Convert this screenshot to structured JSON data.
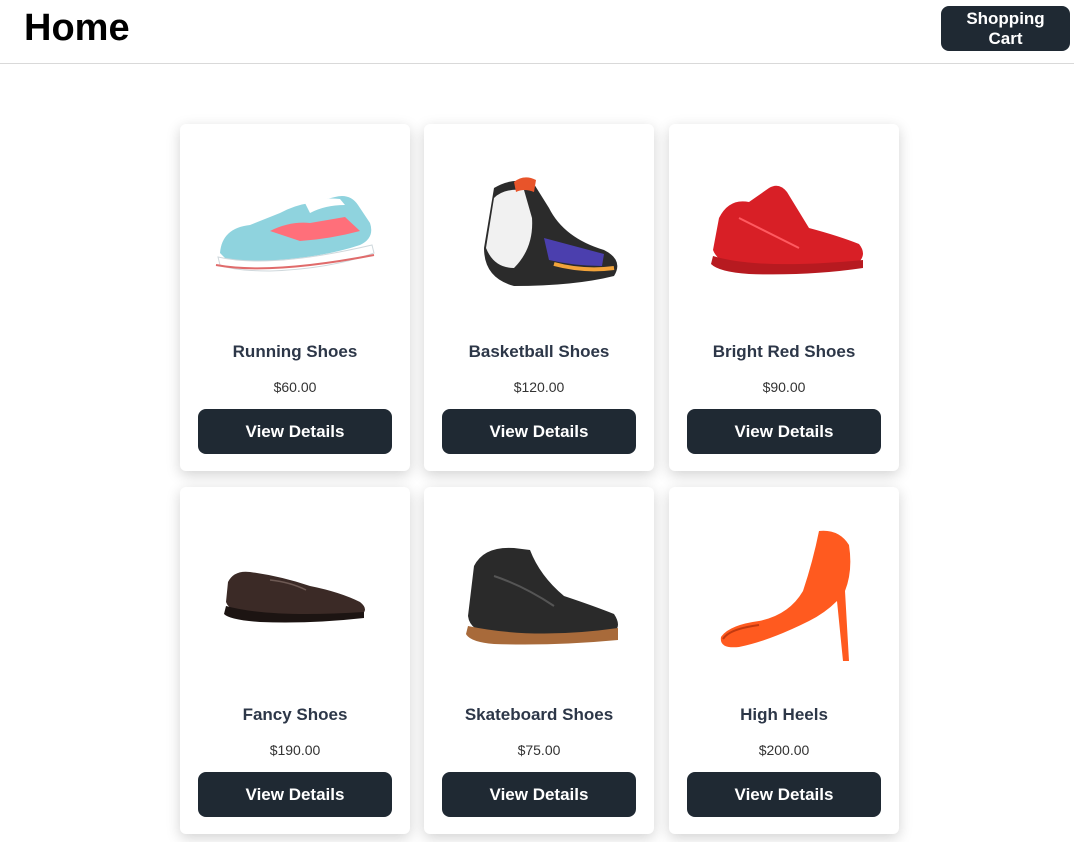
{
  "header": {
    "title": "Home",
    "cart_label": "Shopping Cart"
  },
  "products": [
    {
      "name": "Running Shoes",
      "price": "$60.00",
      "button": "View Details",
      "icon": "running-shoe-icon"
    },
    {
      "name": "Basketball Shoes",
      "price": "$120.00",
      "button": "View Details",
      "icon": "basketball-shoe-icon"
    },
    {
      "name": "Bright Red Shoes",
      "price": "$90.00",
      "button": "View Details",
      "icon": "red-shoe-icon"
    },
    {
      "name": "Fancy Shoes",
      "price": "$190.00",
      "button": "View Details",
      "icon": "dress-shoe-icon"
    },
    {
      "name": "Skateboard Shoes",
      "price": "$75.00",
      "button": "View Details",
      "icon": "skate-shoe-icon"
    },
    {
      "name": "High Heels",
      "price": "$200.00",
      "button": "View Details",
      "icon": "high-heel-icon"
    }
  ],
  "colors": {
    "button_bg": "#1f2933",
    "button_text": "#ffffff",
    "name_text": "#2d3748"
  }
}
